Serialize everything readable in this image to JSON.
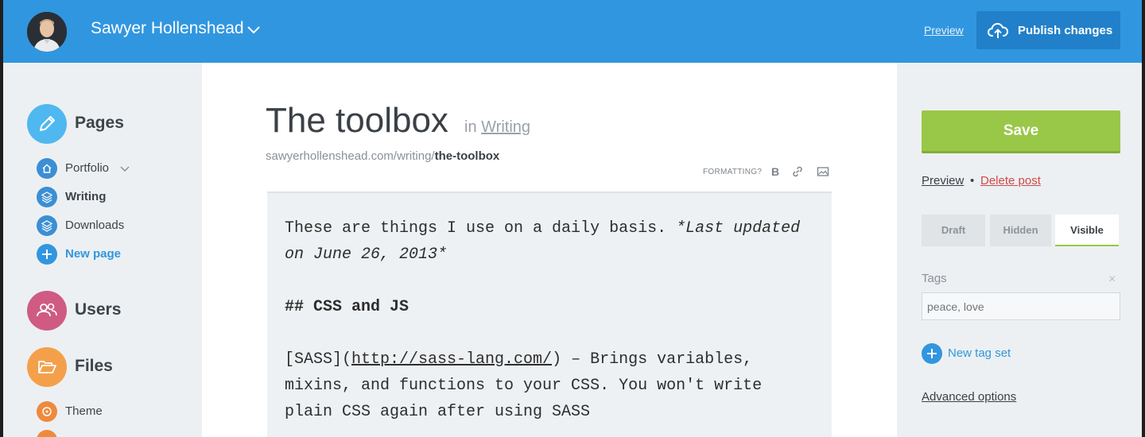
{
  "header": {
    "user_name": "Sawyer Hollenshead",
    "preview_label": "Preview",
    "publish_label": "Publish changes"
  },
  "sidebar": {
    "pages": {
      "title": "Pages",
      "items": [
        {
          "label": "Portfolio",
          "icon": "home-icon"
        },
        {
          "label": "Writing",
          "icon": "layers-icon",
          "active": true
        },
        {
          "label": "Downloads",
          "icon": "layers-icon"
        },
        {
          "label": "New page",
          "icon": "plus-icon"
        }
      ]
    },
    "users": {
      "title": "Users"
    },
    "files": {
      "title": "Files",
      "items": [
        {
          "label": "Theme",
          "icon": "theme-icon"
        }
      ]
    }
  },
  "editor": {
    "title": "The toolbox",
    "in_prefix": "in",
    "category": "Writing",
    "slug_base": "sawyerhollenshead.com/writing/",
    "slug": "the-toolbox",
    "formatting_label": "FORMATTING?",
    "body": {
      "p1_text": "These are things I use on a daily basis. ",
      "p1_italic": "*Last updated on June 26, 2013*",
      "heading": "## CSS and JS",
      "p2_link_text": "[SASS](",
      "p2_url": "http://sass-lang.com/",
      "p2_rest": ") – Brings variables, mixins, and functions to your CSS. You won't write plain CSS again after using SASS"
    }
  },
  "right": {
    "save_label": "Save",
    "preview_label": "Preview",
    "separator": "•",
    "delete_label": "Delete post",
    "visibility": [
      "Draft",
      "Hidden",
      "Visible"
    ],
    "visibility_selected": "Visible",
    "tags_label": "Tags",
    "tags_value": "peace, love",
    "new_tag_set_label": "New tag set",
    "advanced_label": "Advanced options"
  },
  "colors": {
    "header_blue": "#3196e0",
    "save_green": "#99c748",
    "delete_red": "#cc4b4b",
    "pages_circle": "#4fb8f0",
    "users_circle": "#cf5b82",
    "files_circle": "#f4a04b"
  }
}
